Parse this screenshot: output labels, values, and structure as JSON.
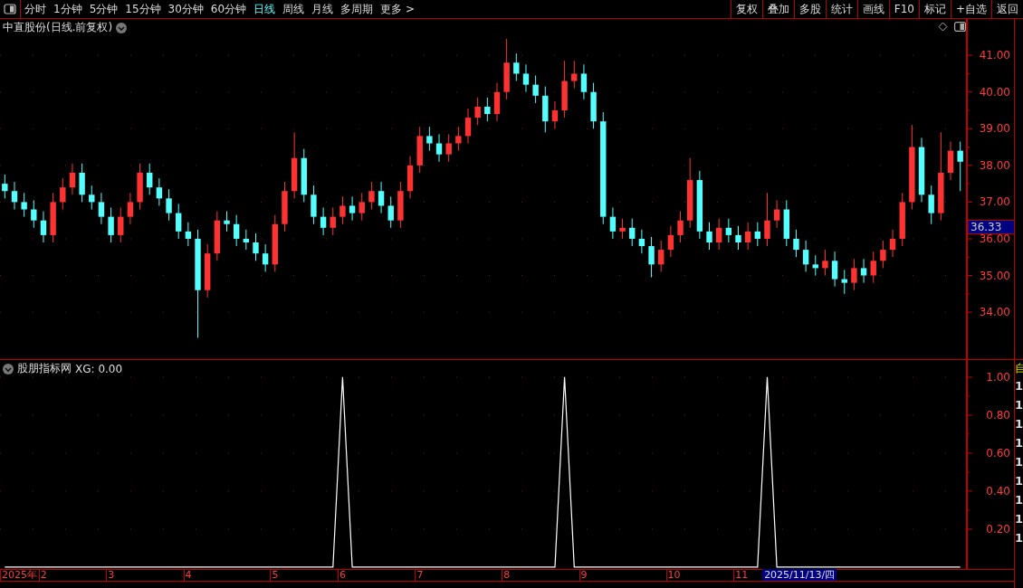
{
  "toolbar": {
    "periods": [
      {
        "label": "分时",
        "selected": false
      },
      {
        "label": "1分钟",
        "selected": false
      },
      {
        "label": "5分钟",
        "selected": false
      },
      {
        "label": "15分钟",
        "selected": false
      },
      {
        "label": "30分钟",
        "selected": false
      },
      {
        "label": "60分钟",
        "selected": false
      },
      {
        "label": "日线",
        "selected": true
      },
      {
        "label": "周线",
        "selected": false
      },
      {
        "label": "月线",
        "selected": false
      },
      {
        "label": "多周期",
        "selected": false
      },
      {
        "label": "更多 >",
        "selected": false
      }
    ],
    "buttons": [
      "复权",
      "叠加",
      "多股",
      "统计",
      "画线",
      "F10",
      "标记",
      "+自选",
      "返回"
    ]
  },
  "price_panel": {
    "title": "中直股份(日线.前复权)",
    "last_price": "36.33",
    "chart_data": {
      "type": "candlestick",
      "grid": true,
      "ylim": [
        32.72,
        41.99
      ],
      "yticks": [
        {
          "value": 41,
          "label": "41.00"
        },
        {
          "value": 40,
          "label": "40.00"
        },
        {
          "value": 39,
          "label": "39.00"
        },
        {
          "value": 38,
          "label": "38.00"
        },
        {
          "value": 37,
          "label": "37.00"
        },
        {
          "value": 36,
          "label": "36.00"
        },
        {
          "value": 35,
          "label": "35.00"
        },
        {
          "value": 34,
          "label": "34.00"
        }
      ],
      "ohlc": [
        [
          37.5,
          37.75,
          37.1,
          37.3
        ],
        [
          37.3,
          37.55,
          36.8,
          37.0
        ],
        [
          37.0,
          37.25,
          36.6,
          36.8
        ],
        [
          36.8,
          37.05,
          36.3,
          36.5
        ],
        [
          36.5,
          36.75,
          35.9,
          36.1
        ],
        [
          36.1,
          37.25,
          35.9,
          37.0
        ],
        [
          37.0,
          37.65,
          36.8,
          37.4
        ],
        [
          37.4,
          38.05,
          37.2,
          37.8
        ],
        [
          37.8,
          38.05,
          37.0,
          37.2
        ],
        [
          37.2,
          37.45,
          36.8,
          37.0
        ],
        [
          37.0,
          37.25,
          36.4,
          36.6
        ],
        [
          36.6,
          36.85,
          35.9,
          36.1
        ],
        [
          36.1,
          36.85,
          35.9,
          36.6
        ],
        [
          36.6,
          37.25,
          36.4,
          37.0
        ],
        [
          37.0,
          38.05,
          36.8,
          37.8
        ],
        [
          37.8,
          38.05,
          37.2,
          37.4
        ],
        [
          37.4,
          37.65,
          36.9,
          37.1
        ],
        [
          37.1,
          37.35,
          36.5,
          36.7
        ],
        [
          36.7,
          36.95,
          36.0,
          36.2
        ],
        [
          36.2,
          36.45,
          35.8,
          36.0
        ],
        [
          36.0,
          36.25,
          33.3,
          34.6
        ],
        [
          34.6,
          35.85,
          34.4,
          35.6
        ],
        [
          35.6,
          36.75,
          35.4,
          36.5
        ],
        [
          36.5,
          36.75,
          36.2,
          36.4
        ],
        [
          36.4,
          36.65,
          35.8,
          36.0
        ],
        [
          36.0,
          36.25,
          35.7,
          35.9
        ],
        [
          35.9,
          36.15,
          35.4,
          35.6
        ],
        [
          35.6,
          35.85,
          35.1,
          35.3
        ],
        [
          35.3,
          36.65,
          35.1,
          36.4
        ],
        [
          36.4,
          37.55,
          36.2,
          37.3
        ],
        [
          37.3,
          38.9,
          37.1,
          38.2
        ],
        [
          38.2,
          38.45,
          37.0,
          37.2
        ],
        [
          37.2,
          37.45,
          36.4,
          36.6
        ],
        [
          36.6,
          36.85,
          36.1,
          36.3
        ],
        [
          36.3,
          36.85,
          36.1,
          36.6
        ],
        [
          36.6,
          37.15,
          36.4,
          36.9
        ],
        [
          36.9,
          37.15,
          36.5,
          36.7
        ],
        [
          36.7,
          37.25,
          36.5,
          37.0
        ],
        [
          37.0,
          37.55,
          36.8,
          37.3
        ],
        [
          37.3,
          37.55,
          36.7,
          36.9
        ],
        [
          36.9,
          37.15,
          36.3,
          36.5
        ],
        [
          36.5,
          37.55,
          36.3,
          37.3
        ],
        [
          37.3,
          38.25,
          37.1,
          38.0
        ],
        [
          38.0,
          39.05,
          37.8,
          38.8
        ],
        [
          38.8,
          39.05,
          38.4,
          38.6
        ],
        [
          38.6,
          38.85,
          38.1,
          38.3
        ],
        [
          38.3,
          38.85,
          38.1,
          38.6
        ],
        [
          38.6,
          39.05,
          38.4,
          38.8
        ],
        [
          38.8,
          39.55,
          38.6,
          39.3
        ],
        [
          39.3,
          39.85,
          39.1,
          39.6
        ],
        [
          39.6,
          39.85,
          39.2,
          39.4
        ],
        [
          39.4,
          40.25,
          39.2,
          40.0
        ],
        [
          40.0,
          41.45,
          39.8,
          40.8
        ],
        [
          40.8,
          41.05,
          40.3,
          40.5
        ],
        [
          40.5,
          40.75,
          40.0,
          40.2
        ],
        [
          40.2,
          40.45,
          39.7,
          39.9
        ],
        [
          39.9,
          40.15,
          38.9,
          39.2
        ],
        [
          39.2,
          39.75,
          39.0,
          39.5
        ],
        [
          39.5,
          40.85,
          39.3,
          40.3
        ],
        [
          40.3,
          40.85,
          40.1,
          40.5
        ],
        [
          40.5,
          40.75,
          39.8,
          40.0
        ],
        [
          40.0,
          40.25,
          39.0,
          39.2
        ],
        [
          39.2,
          39.45,
          36.4,
          36.6
        ],
        [
          36.6,
          36.85,
          36.0,
          36.2
        ],
        [
          36.2,
          36.55,
          36.0,
          36.3
        ],
        [
          36.3,
          36.55,
          35.8,
          36.0
        ],
        [
          36.0,
          36.25,
          35.6,
          35.8
        ],
        [
          35.8,
          36.05,
          34.95,
          35.3
        ],
        [
          35.3,
          35.95,
          35.1,
          35.7
        ],
        [
          35.7,
          36.35,
          35.5,
          36.1
        ],
        [
          36.1,
          36.75,
          35.9,
          36.5
        ],
        [
          36.5,
          38.2,
          36.3,
          37.6
        ],
        [
          37.6,
          37.85,
          36.0,
          36.2
        ],
        [
          36.2,
          36.45,
          35.7,
          35.9
        ],
        [
          35.9,
          36.55,
          35.7,
          36.3
        ],
        [
          36.3,
          36.55,
          35.9,
          36.1
        ],
        [
          36.1,
          36.35,
          35.7,
          35.9
        ],
        [
          35.9,
          36.45,
          35.7,
          36.2
        ],
        [
          36.2,
          36.45,
          35.8,
          36.0
        ],
        [
          36.0,
          37.25,
          35.8,
          36.5
        ],
        [
          36.5,
          37.05,
          36.3,
          36.8
        ],
        [
          36.8,
          37.05,
          35.8,
          36.0
        ],
        [
          36.0,
          36.25,
          35.5,
          35.7
        ],
        [
          35.7,
          35.95,
          35.1,
          35.3
        ],
        [
          35.3,
          35.55,
          35.0,
          35.2
        ],
        [
          35.2,
          35.7,
          35.0,
          35.4
        ],
        [
          35.4,
          35.65,
          34.7,
          34.9
        ],
        [
          34.9,
          35.15,
          34.5,
          34.8
        ],
        [
          34.8,
          35.45,
          34.6,
          35.2
        ],
        [
          35.2,
          35.45,
          34.8,
          35.0
        ],
        [
          35.0,
          35.65,
          34.8,
          35.4
        ],
        [
          35.4,
          35.95,
          35.2,
          35.7
        ],
        [
          35.7,
          36.25,
          35.5,
          36.0
        ],
        [
          36.0,
          37.25,
          35.8,
          37.0
        ],
        [
          37.0,
          39.1,
          36.8,
          38.5
        ],
        [
          38.5,
          38.75,
          37.0,
          37.2
        ],
        [
          37.2,
          37.45,
          36.4,
          36.7
        ],
        [
          36.7,
          38.9,
          36.5,
          37.8
        ],
        [
          37.8,
          38.65,
          37.6,
          38.4
        ],
        [
          38.4,
          38.65,
          37.3,
          38.1
        ]
      ]
    }
  },
  "indicator_panel": {
    "title": "股朋指标网",
    "reading": "XG: 0.00",
    "chart_data": {
      "type": "line",
      "grid": true,
      "ylim": [
        -0.01,
        1.09
      ],
      "yticks": [
        {
          "value": 1,
          "label": "1.00"
        },
        {
          "value": 0.8,
          "label": "0.80"
        },
        {
          "value": 0.6,
          "label": "0.60"
        },
        {
          "value": 0.4,
          "label": "0.40"
        },
        {
          "value": 0.2,
          "label": "0.20"
        }
      ],
      "series": [
        {
          "color": "#ffffff",
          "values": [
            0,
            0,
            0,
            0,
            0,
            0,
            0,
            0,
            0,
            0,
            0,
            0,
            0,
            0,
            0,
            0,
            0,
            0,
            0,
            0,
            0,
            0,
            0,
            0,
            0,
            0,
            0,
            0,
            0,
            0,
            0,
            0,
            0,
            0,
            0,
            1,
            0,
            0,
            0,
            0,
            0,
            0,
            0,
            0,
            0,
            0,
            0,
            0,
            0,
            0,
            0,
            0,
            0,
            0,
            0,
            0,
            0,
            0,
            1,
            0,
            0,
            0,
            0,
            0,
            0,
            0,
            0,
            0,
            0,
            0,
            0,
            0,
            0,
            0,
            0,
            0,
            0,
            0,
            0,
            1,
            0,
            0,
            0,
            0,
            0,
            0,
            0,
            0,
            0,
            0,
            0,
            0,
            0,
            0,
            0,
            0,
            0,
            0,
            0,
            0
          ]
        }
      ]
    }
  },
  "x_axis": {
    "labels": [
      "2025年",
      "2",
      "3",
      "4",
      "5",
      "6",
      "7",
      "8",
      "9",
      "10",
      "11"
    ],
    "cursor_label": "2025/11/13/四"
  },
  "side_column": {
    "header": "自",
    "values": [
      "1",
      "1",
      "1",
      "1",
      "1",
      "1",
      "1",
      "1",
      "1"
    ]
  }
}
